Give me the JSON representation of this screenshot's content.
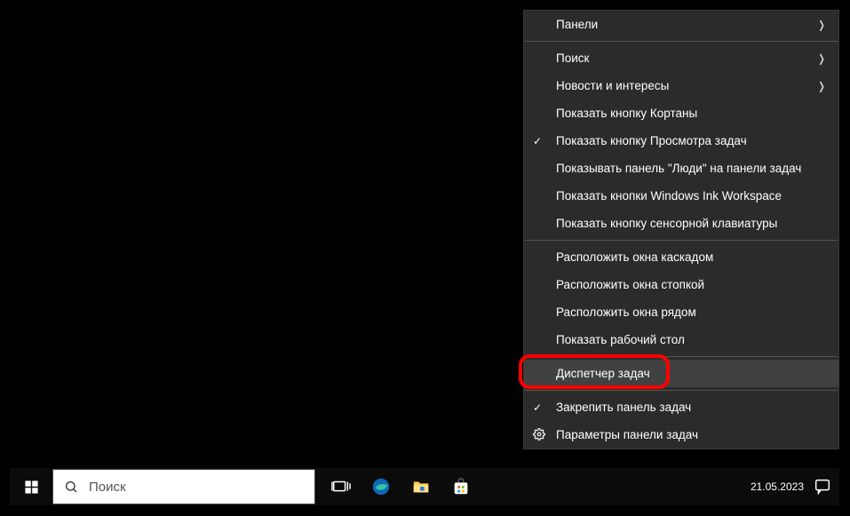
{
  "context_menu": {
    "items": {
      "panels": "Панели",
      "search": "Поиск",
      "news": "Новости и интересы",
      "show_cortana": "Показать кнопку Кортаны",
      "show_taskview": "Показать кнопку Просмотра задач",
      "show_people": "Показывать панель \"Люди\" на панели задач",
      "show_ink": "Показать кнопки Windows Ink Workspace",
      "show_touch_kbd": "Показать кнопку сенсорной клавиатуры",
      "cascade": "Расположить окна каскадом",
      "stack": "Расположить окна стопкой",
      "side_by_side": "Расположить окна рядом",
      "show_desktop": "Показать рабочий стол",
      "task_manager": "Диспетчер задач",
      "lock_taskbar": "Закрепить панель задач",
      "taskbar_settings": "Параметры панели задач"
    }
  },
  "taskbar": {
    "search_placeholder": "Поиск",
    "date": "21.05.2023"
  }
}
